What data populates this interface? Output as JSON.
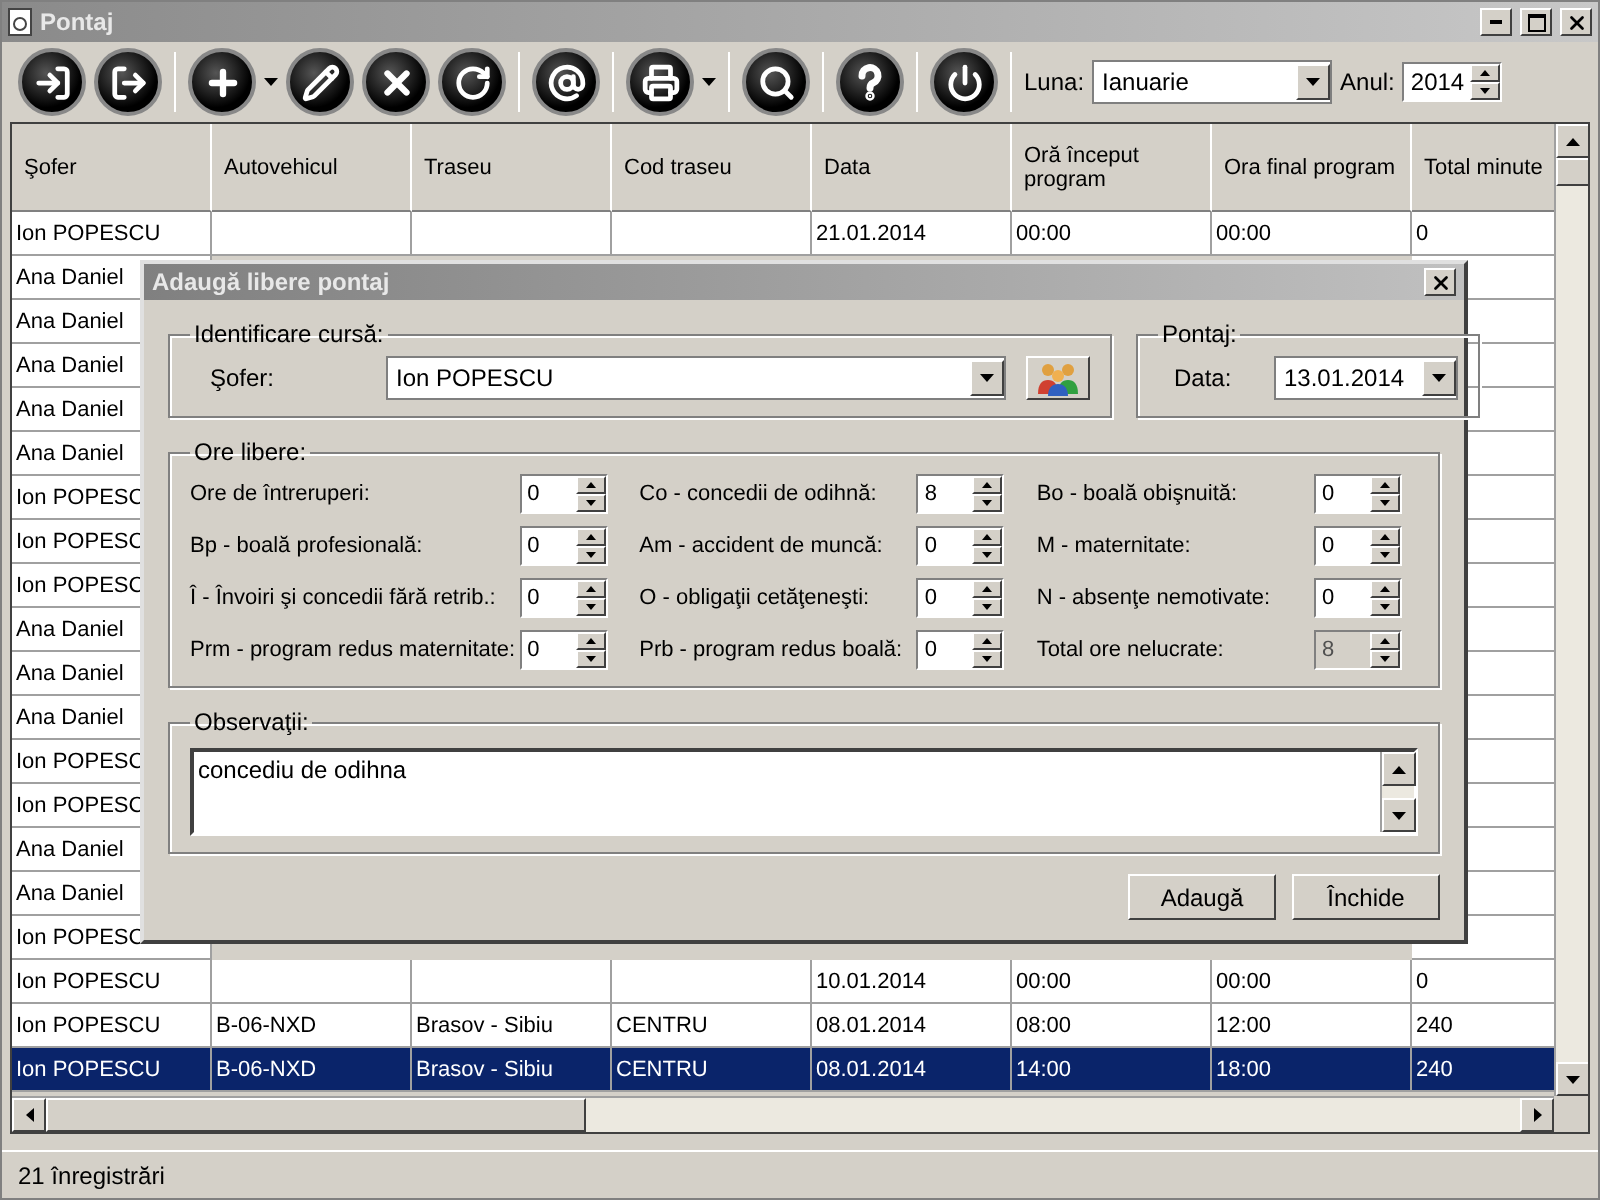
{
  "window": {
    "title": "Pontaj"
  },
  "toolbar": {
    "month_label": "Luna:",
    "month_value": "Ianuarie",
    "year_label": "Anul:",
    "year_value": "2014"
  },
  "table": {
    "columns": [
      "Şofer",
      "Autovehicul",
      "Traseu",
      "Cod traseu",
      "Data",
      "Oră început program",
      "Ora final program",
      "Total minute"
    ],
    "rows": [
      {
        "cells": [
          "Ion POPESCU",
          "",
          "",
          "",
          "21.01.2014",
          "00:00",
          "00:00",
          "0"
        ],
        "selected": false
      },
      {
        "cells": [
          "Ana Daniel"
        ],
        "selected": false
      },
      {
        "cells": [
          "Ana Daniel"
        ],
        "selected": false
      },
      {
        "cells": [
          "Ana Daniel"
        ],
        "selected": false
      },
      {
        "cells": [
          "Ana Daniel"
        ],
        "selected": false
      },
      {
        "cells": [
          "Ana Daniel"
        ],
        "selected": false
      },
      {
        "cells": [
          "Ion POPESC"
        ],
        "selected": false
      },
      {
        "cells": [
          "Ion POPESC"
        ],
        "selected": false
      },
      {
        "cells": [
          "Ion POPESC"
        ],
        "selected": false
      },
      {
        "cells": [
          "Ana Daniel"
        ],
        "selected": false
      },
      {
        "cells": [
          "Ana Daniel"
        ],
        "selected": false
      },
      {
        "cells": [
          "Ana Daniel"
        ],
        "selected": false
      },
      {
        "cells": [
          "Ion POPESC"
        ],
        "selected": false
      },
      {
        "cells": [
          "Ion POPESC"
        ],
        "selected": false
      },
      {
        "cells": [
          "Ana Daniel"
        ],
        "selected": false
      },
      {
        "cells": [
          "Ana Daniel"
        ],
        "selected": false
      },
      {
        "cells": [
          "Ion POPESC"
        ],
        "selected": false
      },
      {
        "cells": [
          "Ion POPESCU",
          "",
          "",
          "",
          "10.01.2014",
          "00:00",
          "00:00",
          "0"
        ],
        "selected": false
      },
      {
        "cells": [
          "Ion POPESCU",
          "B-06-NXD",
          "Brasov - Sibiu",
          "CENTRU",
          "08.01.2014",
          "08:00",
          "12:00",
          "240"
        ],
        "selected": false
      },
      {
        "cells": [
          "Ion POPESCU",
          "B-06-NXD",
          "Brasov - Sibiu",
          "CENTRU",
          "08.01.2014",
          "14:00",
          "18:00",
          "240"
        ],
        "selected": true
      }
    ]
  },
  "status_bar": "21 înregistrări",
  "dialog": {
    "title": "Adaugă libere pontaj",
    "trip_group": {
      "title": "Identificare cursă:",
      "driver_label": "Şofer:",
      "driver_value": "Ion POPESCU"
    },
    "timesheet_group": {
      "title": "Pontaj:",
      "date_label": "Data:",
      "date_value": "13.01.2014"
    },
    "hours_group": {
      "title": "Ore libere:",
      "fields": [
        {
          "label": "Ore de întreruperi:",
          "value": "0",
          "disabled": false
        },
        {
          "label": "Co - concedii de odihnă:",
          "value": "8",
          "disabled": false
        },
        {
          "label": "Bo - boală obişnuită:",
          "value": "0",
          "disabled": false
        },
        {
          "label": "Bp - boală profesională:",
          "value": "0",
          "disabled": false
        },
        {
          "label": "Am - accident de muncă:",
          "value": "0",
          "disabled": false
        },
        {
          "label": "M - maternitate:",
          "value": "0",
          "disabled": false
        },
        {
          "label": "Î - Învoiri şi concedii fără retrib.:",
          "value": "0",
          "disabled": false
        },
        {
          "label": "O - obligaţii cetăţeneşti:",
          "value": "0",
          "disabled": false
        },
        {
          "label": "N - absenţe nemotivate:",
          "value": "0",
          "disabled": false
        },
        {
          "label": "Prm - program redus maternitate:",
          "value": "0",
          "disabled": false
        },
        {
          "label": "Prb - program redus boală:",
          "value": "0",
          "disabled": false
        },
        {
          "label": "Total ore nelucrate:",
          "value": "8",
          "disabled": true
        }
      ]
    },
    "notes_group": {
      "title": "Observaţii:",
      "value": "concediu de odihna"
    },
    "buttons": [
      "Adaugă",
      "Închide"
    ]
  }
}
